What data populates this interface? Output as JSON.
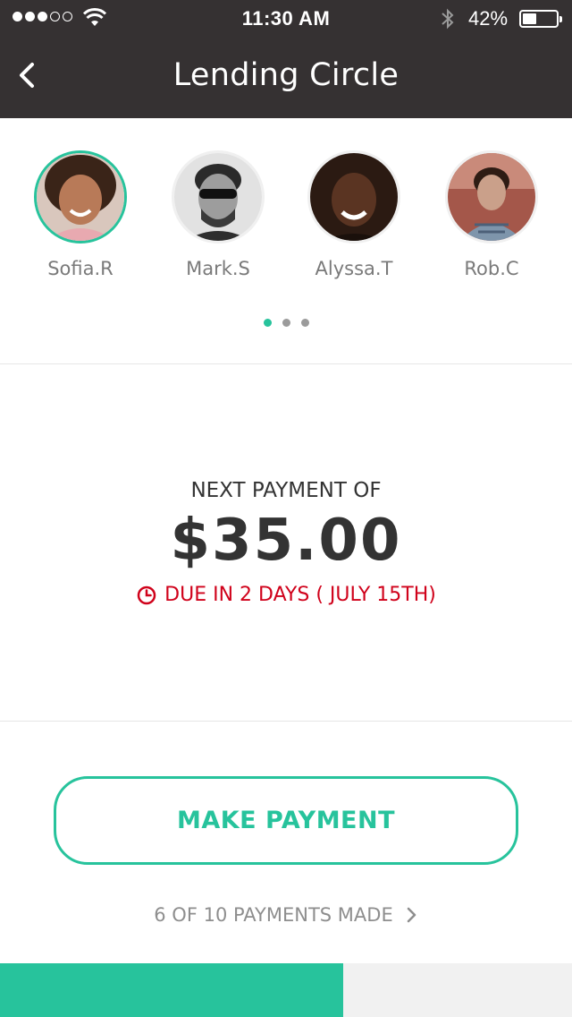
{
  "status_bar": {
    "time": "11:30 AM",
    "battery_percent": "42%",
    "battery_level": 0.42,
    "signal_bars_filled": 3,
    "signal_bars_total": 5
  },
  "nav": {
    "back_icon": "chevron-left-icon",
    "title": "Lending Circle"
  },
  "members": [
    {
      "name": "Sofia.R",
      "active": true
    },
    {
      "name": "Mark.S",
      "active": false
    },
    {
      "name": "Alyssa.T",
      "active": false
    },
    {
      "name": "Rob.C",
      "active": false
    }
  ],
  "pager": {
    "pages": 3,
    "current": 1
  },
  "payment": {
    "label": "NEXT PAYMENT OF",
    "amount": "$35.00",
    "due_text": "DUE IN 2 DAYS ( JULY 15TH)",
    "due_icon": "clock-icon"
  },
  "actions": {
    "make_payment_label": "MAKE PAYMENT",
    "progress_text": "6 OF 10 PAYMENTS MADE",
    "progress_icon": "chevron-right-icon"
  },
  "progress": {
    "made": 6,
    "total": 10
  },
  "colors": {
    "header_bg": "#353132",
    "accent": "#27c39c",
    "due": "#d0021b",
    "progress_track": "#f1f1f1"
  }
}
